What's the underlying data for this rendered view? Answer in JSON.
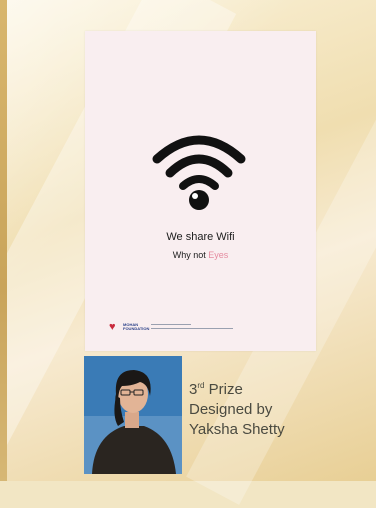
{
  "poster": {
    "line1": "We share Wifi",
    "line2_prefix": "Why not ",
    "line2_accent": "Eyes",
    "logo_text": "MOHAN FOUNDATION"
  },
  "caption": {
    "place_number": "3",
    "place_suffix": "rd",
    "place_word": "Prize",
    "line2": "Designed by",
    "line3": "Yaksha Shetty"
  },
  "colors": {
    "accent": "#e58ca0",
    "heart": "#c92a3c",
    "caption_text": "#4a4a40"
  },
  "icons": [
    "wifi-eye-icon",
    "heart-logo-icon"
  ]
}
